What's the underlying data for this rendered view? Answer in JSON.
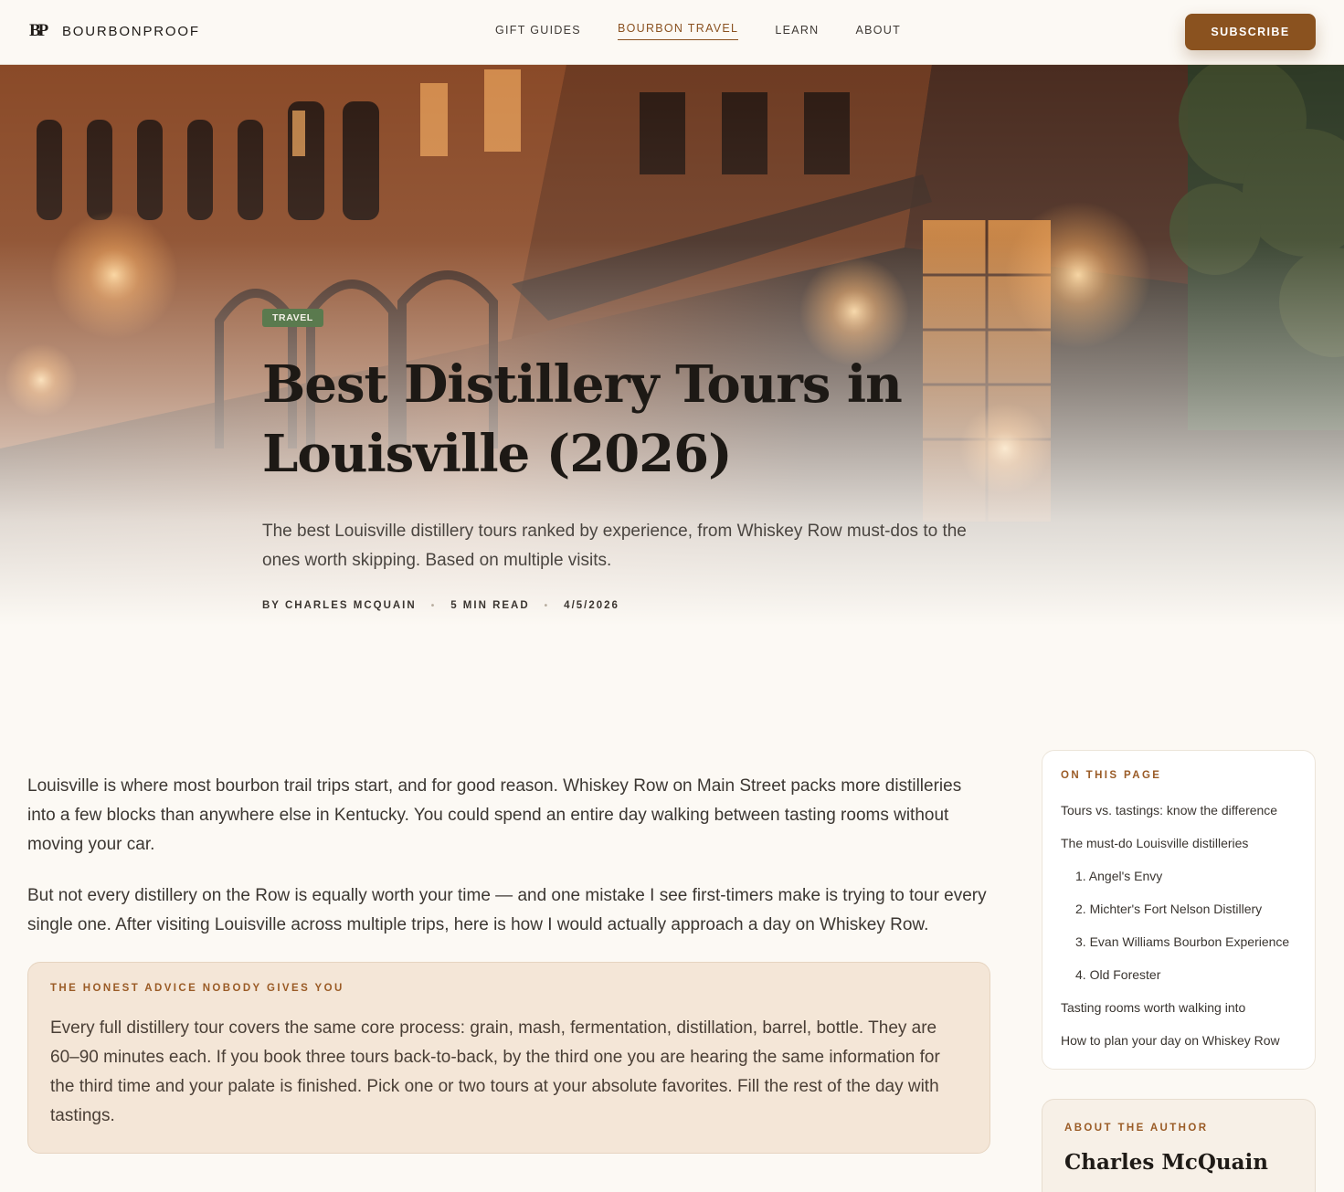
{
  "header": {
    "logo_mark": "BP",
    "logo_text": "BOURBONPROOF",
    "nav": [
      {
        "label": "GIFT GUIDES",
        "active": false
      },
      {
        "label": "BOURBON TRAVEL",
        "active": true
      },
      {
        "label": "LEARN",
        "active": false
      },
      {
        "label": "ABOUT",
        "active": false
      }
    ],
    "subscribe_label": "SUBSCRIBE"
  },
  "hero": {
    "category": "TRAVEL",
    "title": "Best Distillery Tours in Louisville (2026)",
    "dek": "The best Louisville distillery tours ranked by experience, from Whiskey Row must-dos to the ones worth skipping. Based on multiple visits.",
    "meta": {
      "author": "BY CHARLES MCQUAIN",
      "read_time": "5 MIN READ",
      "date": "4/5/2026",
      "separator": "•"
    }
  },
  "article": {
    "paragraphs": [
      "Louisville is where most bourbon trail trips start, and for good reason. Whiskey Row on Main Street packs more distilleries into a few blocks than anywhere else in Kentucky. You could spend an entire day walking between tasting rooms without moving your car.",
      "But not every distillery on the Row is equally worth your time — and one mistake I see first-timers make is trying to tour every single one. After visiting Louisville across multiple trips, here is how I would actually approach a day on Whiskey Row."
    ],
    "callout": {
      "label": "THE HONEST ADVICE NOBODY GIVES YOU",
      "text": "Every full distillery tour covers the same core process: grain, mash, fermentation, distillation, barrel, bottle. They are 60–90 minutes each. If you book three tours back-to-back, by the third one you are hearing the same information for the third time and your palate is finished. Pick one or two tours at your absolute favorites. Fill the rest of the day with tastings."
    }
  },
  "sidebar": {
    "toc_label": "ON THIS PAGE",
    "toc": [
      {
        "label": "Tours vs. tastings: know the difference",
        "sub": false
      },
      {
        "label": "The must-do Louisville distilleries",
        "sub": false
      },
      {
        "label": "1. Angel's Envy",
        "sub": true
      },
      {
        "label": "2. Michter's Fort Nelson Distillery",
        "sub": true
      },
      {
        "label": "3. Evan Williams Bourbon Experience",
        "sub": true
      },
      {
        "label": "4. Old Forester",
        "sub": true
      },
      {
        "label": "Tasting rooms worth walking into",
        "sub": false
      },
      {
        "label": "How to plan your day on Whiskey Row",
        "sub": false
      }
    ],
    "author_label": "ABOUT THE AUTHOR",
    "author_name": "Charles McQuain"
  },
  "colors": {
    "accent": "#8a521f",
    "badge": "#5a7a4e",
    "page_bg": "#fcf9f4",
    "callout_bg": "#f4e6d7"
  }
}
